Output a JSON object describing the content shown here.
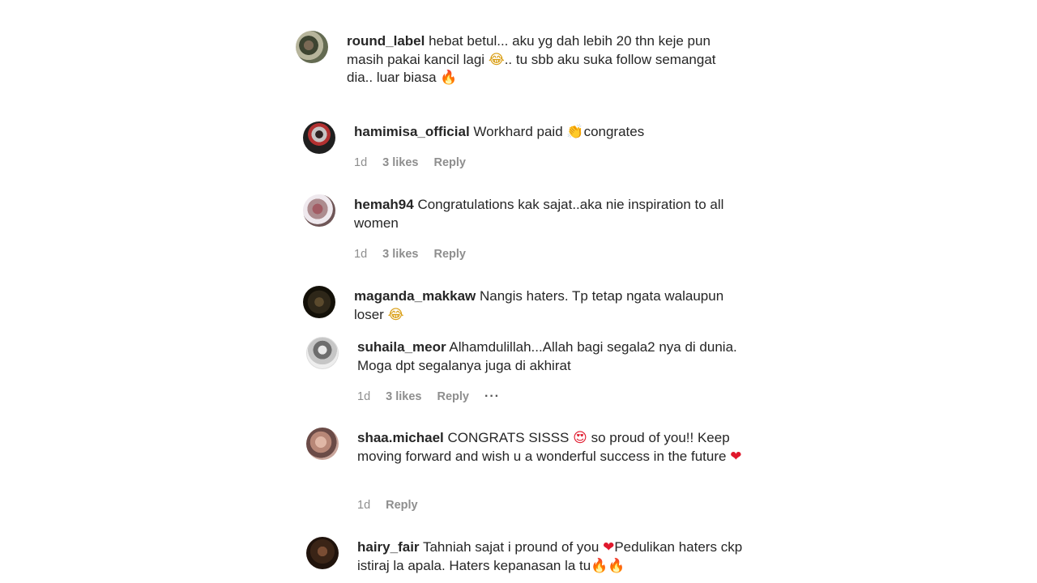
{
  "comments": [
    {
      "username": "round_label",
      "text": "hebat betul... aku yg dah lebih 20 thn keje pun masih pakai kancil lagi",
      "text_after_emoji": ".. tu sbb aku suka follow semangat dia.. luar biasa",
      "emoji_1": "😂",
      "emoji_2": "🔥",
      "avatar_icon": "user-avatar-photo"
    },
    {
      "username": "hamimisa_official",
      "text": "Workhard paid",
      "emoji_1": "👏",
      "text_after_emoji": "congrates",
      "time": "1d",
      "likes": "3 likes",
      "reply": "Reply"
    },
    {
      "username": "hemah94",
      "text": "Congratulations kak sajat..aka nie inspiration to all women",
      "time": "1d",
      "likes": "3 likes",
      "reply": "Reply"
    },
    {
      "username": "maganda_makkaw",
      "text": "Nangis haters. Tp tetap ngata walaupun loser",
      "emoji_1": "😂"
    },
    {
      "username": "suhaila_meor",
      "text": "Alhamdulillah...Allah bagi segala2 nya di dunia. Moga dpt segalanya juga di akhirat",
      "time": "1d",
      "likes": "3 likes",
      "reply": "Reply",
      "more": "···"
    },
    {
      "username": "shaa.michael",
      "text": "CONGRATS SISSS",
      "emoji_1": "😍",
      "text_after_emoji": "so proud of you!! Keep moving forward and wish u a wonderful success in the future",
      "emoji_2": "❤",
      "time": "1d",
      "reply": "Reply"
    },
    {
      "username": "hairy_fair",
      "text": "Tahniah sajat i pround of you",
      "emoji_1": "❤",
      "text_after_emoji": "Pedulikan haters ckp istiraj la apala. Haters kepanasan la tu",
      "emoji_2": "🔥",
      "emoji_3": "🔥"
    }
  ]
}
